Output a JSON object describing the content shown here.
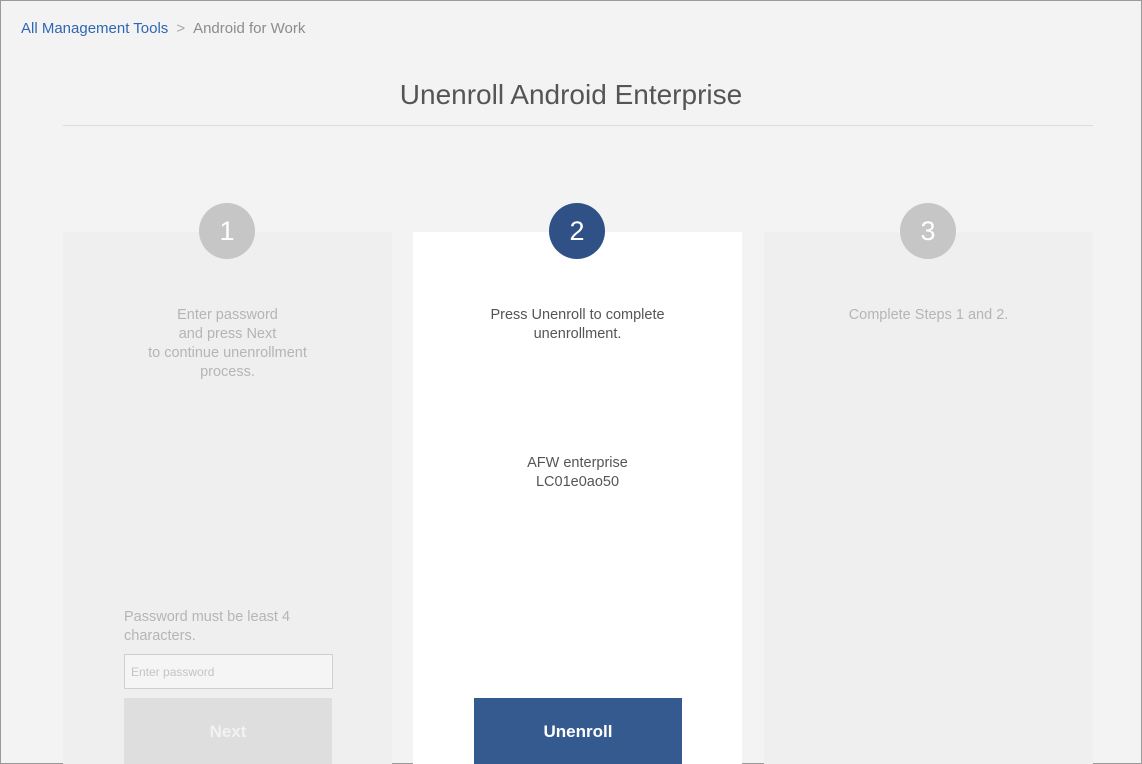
{
  "breadcrumb": {
    "root": "All Management Tools",
    "separator": ">",
    "current": "Android for Work"
  },
  "page": {
    "title": "Unenroll Android Enterprise"
  },
  "steps": [
    {
      "number": "1",
      "state": "disabled",
      "text": "Enter password\nand press Next\nto continue unenrollment\nprocess.",
      "password_hint": "Password must be least 4 characters.",
      "password_placeholder": "Enter password",
      "password_value": "",
      "button_label": "Next"
    },
    {
      "number": "2",
      "state": "active",
      "text": "Press Unenroll to complete\nunenrollment.",
      "enterprise": "AFW enterprise\nLC01e0ao50",
      "button_label": "Unenroll"
    },
    {
      "number": "3",
      "state": "disabled",
      "text": "Complete Steps 1 and 2."
    }
  ],
  "colors": {
    "active_step": "#2f5186",
    "inactive_step": "#c6c6c6",
    "primary_button": "#355a8f",
    "link": "#2f67b2"
  }
}
